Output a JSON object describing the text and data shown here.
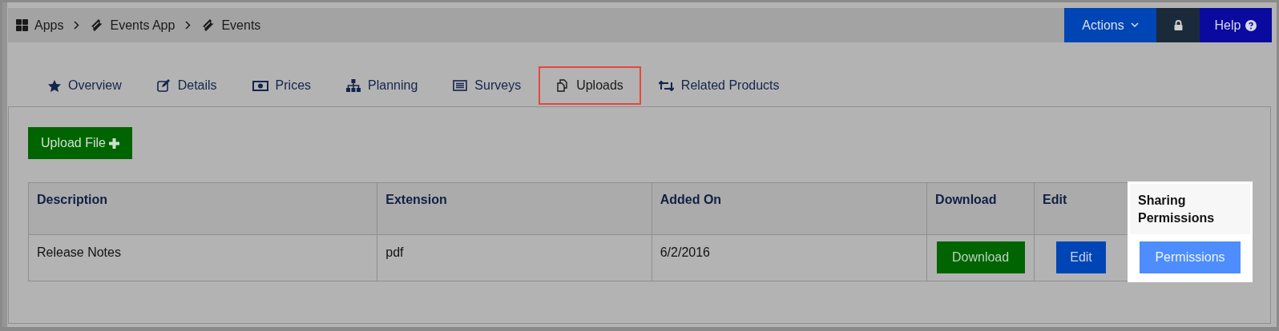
{
  "breadcrumb": [
    {
      "label": "Apps",
      "kind": "grid"
    },
    {
      "label": "Events App",
      "kind": "ticket"
    },
    {
      "label": "Events",
      "kind": "ticket"
    }
  ],
  "toolbar": {
    "actions": "Actions",
    "help": "Help"
  },
  "tabs": [
    {
      "label": "Overview",
      "kind": "star",
      "selected": false
    },
    {
      "label": "Details",
      "kind": "edit",
      "selected": false
    },
    {
      "label": "Prices",
      "kind": "money",
      "selected": false
    },
    {
      "label": "Planning",
      "kind": "sitemap",
      "selected": false
    },
    {
      "label": "Surveys",
      "kind": "list",
      "selected": false
    },
    {
      "label": "Uploads",
      "kind": "files",
      "selected": true
    },
    {
      "label": "Related Products",
      "kind": "retweet",
      "selected": false
    }
  ],
  "upload_button": "Upload File",
  "table": {
    "columns": [
      {
        "label": "Description",
        "highlighted": false
      },
      {
        "label": "Extension",
        "highlighted": false
      },
      {
        "label": "Added On",
        "highlighted": false
      },
      {
        "label": "Download",
        "highlighted": false
      },
      {
        "label": "Edit",
        "highlighted": false
      },
      {
        "label": "Sharing Permissions",
        "highlighted": true
      }
    ],
    "rows": [
      {
        "cells": [
          {
            "kind": "text",
            "text": "Release Notes"
          },
          {
            "kind": "text",
            "text": "pdf"
          },
          {
            "kind": "text",
            "text": "6/2/2016"
          },
          {
            "kind": "download",
            "text": "Download"
          },
          {
            "kind": "edit",
            "text": "Edit"
          },
          {
            "kind": "permissions",
            "text": "Permissions"
          }
        ]
      }
    ]
  }
}
